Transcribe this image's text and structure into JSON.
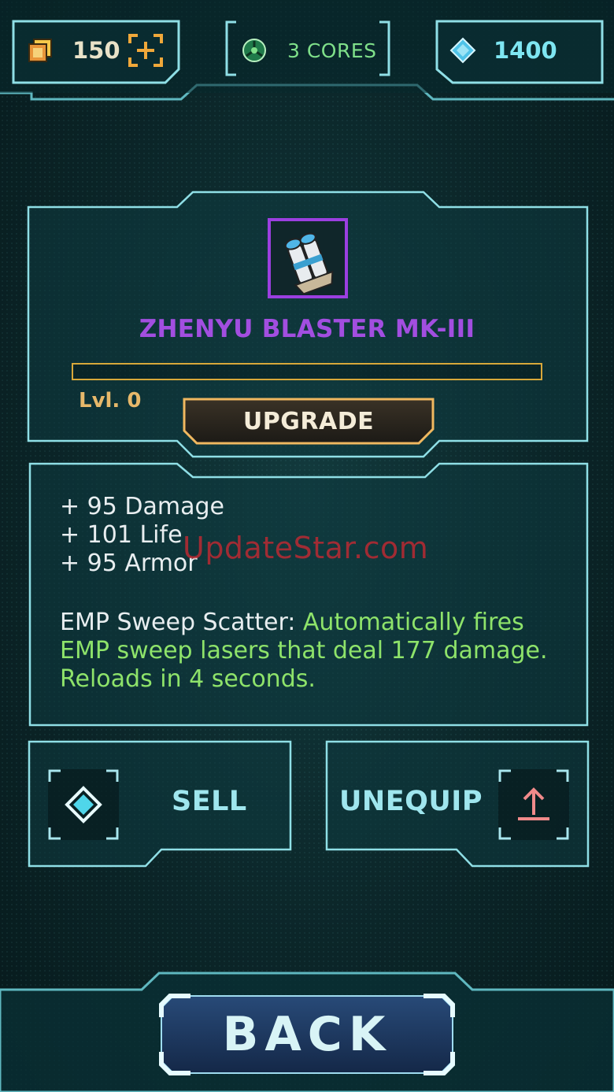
{
  "resources": {
    "scrap_count": "150",
    "cores_label": "3 CORES",
    "gems_count": "1400"
  },
  "item": {
    "name": "ZHENYU BLASTER MK-III",
    "level_label": "Lvl. 0",
    "progress": 0,
    "upgrade_label": "UPGRADE"
  },
  "stats": {
    "damage": "+ 95 Damage",
    "life": "+ 101 Life",
    "armor": "+ 95 Armor"
  },
  "ability": {
    "name": "EMP Sweep Scatter:",
    "description": "Automatically fires EMP sweep lasers that deal 177 damage. Reloads in 4 seconds."
  },
  "watermark": "UpdateStar.com",
  "actions": {
    "sell_label": "SELL",
    "unequip_label": "UNEQUIP"
  },
  "back_label": "BACK",
  "colors": {
    "frame": "#7fd9e0",
    "item_name": "#a24ee0",
    "ability_text": "#8ee36a",
    "gold": "#d8a83a"
  }
}
